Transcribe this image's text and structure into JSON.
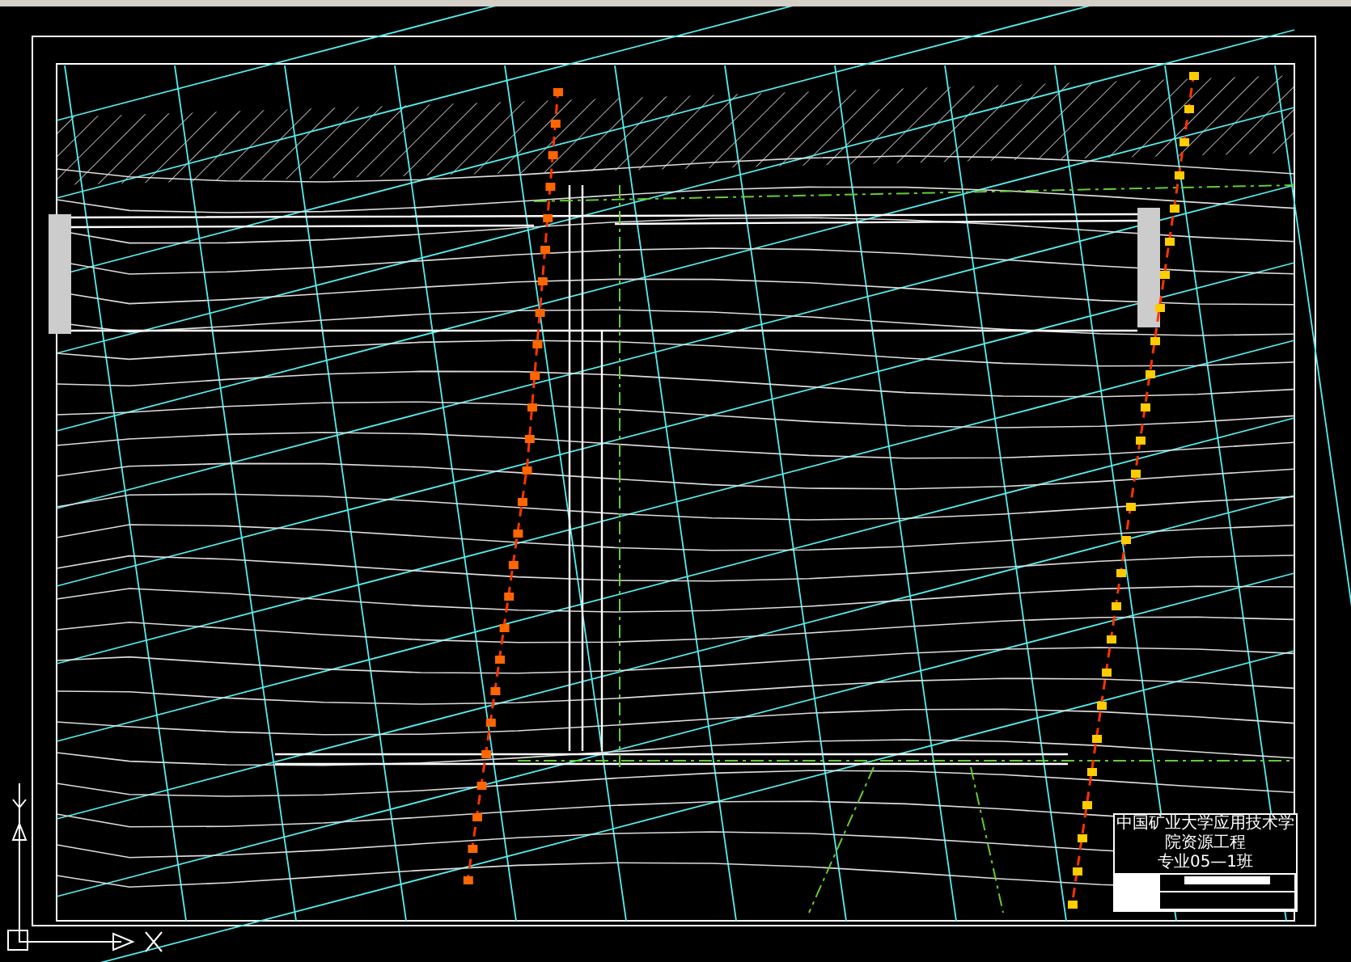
{
  "title_block": {
    "lines": [
      "中国矿业大学应用技术学院资源工程",
      "专业05—1班"
    ]
  }
}
